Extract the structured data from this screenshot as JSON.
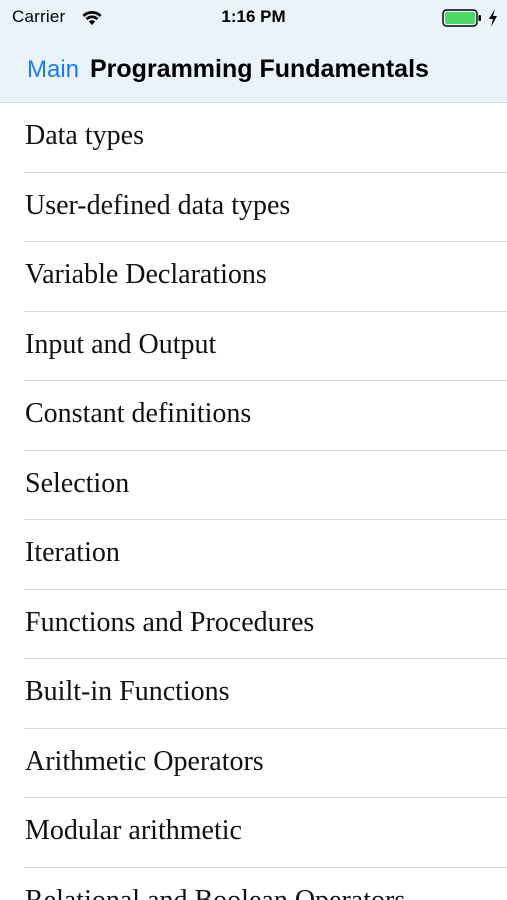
{
  "status_bar": {
    "carrier": "Carrier",
    "time": "1:16 PM",
    "wifi_icon": "wifi-icon",
    "battery_icon": "battery-icon",
    "charging_icon": "bolt-icon",
    "battery_color": "#4cd964"
  },
  "nav": {
    "back_label": "Main",
    "title": "Programming Fundamentals",
    "accent_color": "#1a7cf0"
  },
  "list": {
    "items": [
      "Data types",
      "User-defined data types",
      "Variable Declarations",
      "Input and Output",
      "Constant definitions",
      "Selection",
      "Iteration",
      "Functions and Procedures",
      "Built-in Functions",
      "Arithmetic Operators",
      "Modular arithmetic",
      "Relational and Boolean Operators"
    ]
  }
}
